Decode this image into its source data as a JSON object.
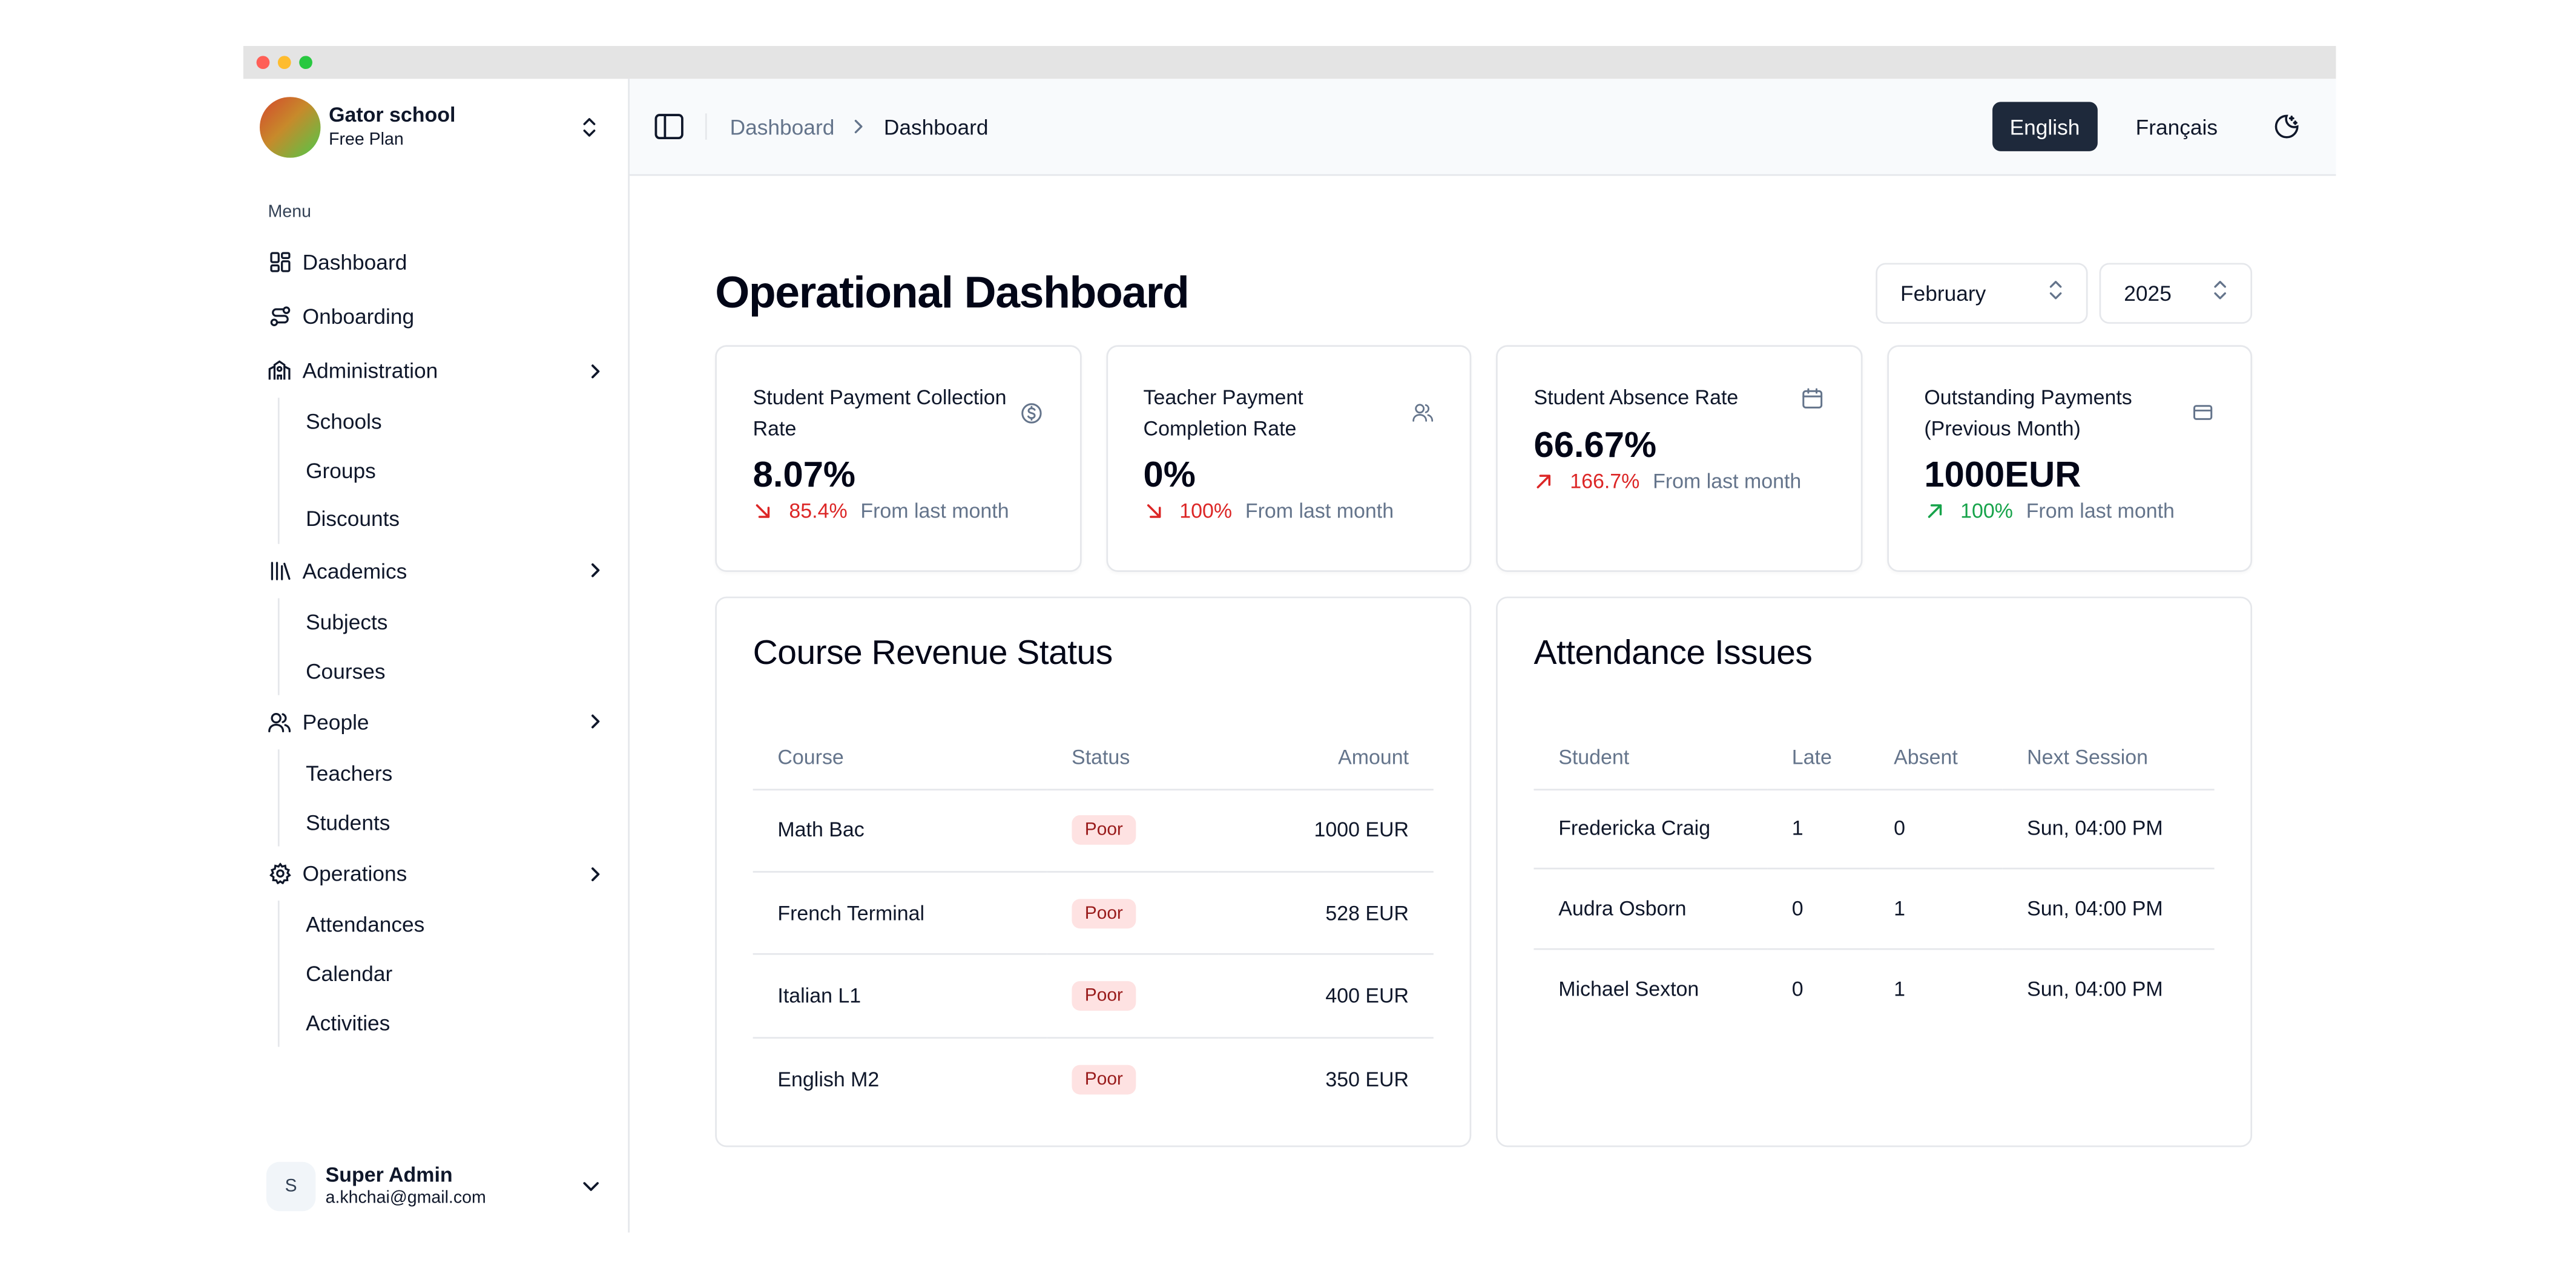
{
  "brand": {
    "name": "Gator school",
    "plan": "Free Plan"
  },
  "sidebar": {
    "menu_label": "Menu",
    "items": [
      {
        "label": "Dashboard",
        "icon": "dashboard-icon"
      },
      {
        "label": "Onboarding",
        "icon": "route-icon"
      },
      {
        "label": "Administration",
        "icon": "school-building-icon",
        "children": [
          "Schools",
          "Groups",
          "Discounts"
        ]
      },
      {
        "label": "Academics",
        "icon": "library-icon",
        "children": [
          "Subjects",
          "Courses"
        ]
      },
      {
        "label": "People",
        "icon": "users-icon",
        "children": [
          "Teachers",
          "Students"
        ]
      },
      {
        "label": "Operations",
        "icon": "gear-icon",
        "children": [
          "Attendances",
          "Calendar",
          "Activities"
        ]
      }
    ]
  },
  "user": {
    "initial": "S",
    "name": "Super Admin",
    "email": "a.khchai@gmail.com"
  },
  "topbar": {
    "breadcrumb_parent": "Dashboard",
    "breadcrumb_current": "Dashboard",
    "lang_active": "English",
    "lang_other": "Français"
  },
  "page": {
    "title": "Operational Dashboard",
    "month": "February",
    "year": "2025"
  },
  "stats": [
    {
      "title": "Student Payment Collection Rate",
      "value": "8.07%",
      "change": "85.4%",
      "trend": "down",
      "from": "From last month",
      "icon": "dollar-circle-icon"
    },
    {
      "title": "Teacher Payment Completion Rate",
      "value": "0%",
      "change": "100%",
      "trend": "down",
      "from": "From last month",
      "icon": "users-icon"
    },
    {
      "title": "Student Absence Rate",
      "value": "66.67%",
      "change": "166.7%",
      "trend": "up-bad",
      "from": "From last month",
      "icon": "calendar-icon"
    },
    {
      "title": "Outstanding Payments (Previous Month)",
      "value": "1000EUR",
      "change": "100%",
      "trend": "up-good",
      "from": "From last month",
      "icon": "credit-card-icon"
    }
  ],
  "colors": {
    "negative": "#dc2626",
    "positive": "#16a34a",
    "accent_dark": "#1e293b"
  },
  "revenue": {
    "title": "Course Revenue Status",
    "headers": [
      "Course",
      "Status",
      "Amount"
    ],
    "rows": [
      {
        "course": "Math Bac",
        "status": "Poor",
        "amount": "1000 EUR"
      },
      {
        "course": "French Terminal",
        "status": "Poor",
        "amount": "528 EUR"
      },
      {
        "course": "Italian L1",
        "status": "Poor",
        "amount": "400 EUR"
      },
      {
        "course": "English M2",
        "status": "Poor",
        "amount": "350 EUR"
      }
    ]
  },
  "attendance": {
    "title": "Attendance Issues",
    "headers": [
      "Student",
      "Late",
      "Absent",
      "Next Session"
    ],
    "rows": [
      {
        "student": "Fredericka Craig",
        "late": "1",
        "absent": "0",
        "next": "Sun, 04:00 PM"
      },
      {
        "student": "Audra Osborn",
        "late": "0",
        "absent": "1",
        "next": "Sun, 04:00 PM"
      },
      {
        "student": "Michael Sexton",
        "late": "0",
        "absent": "1",
        "next": "Sun, 04:00 PM"
      }
    ]
  }
}
